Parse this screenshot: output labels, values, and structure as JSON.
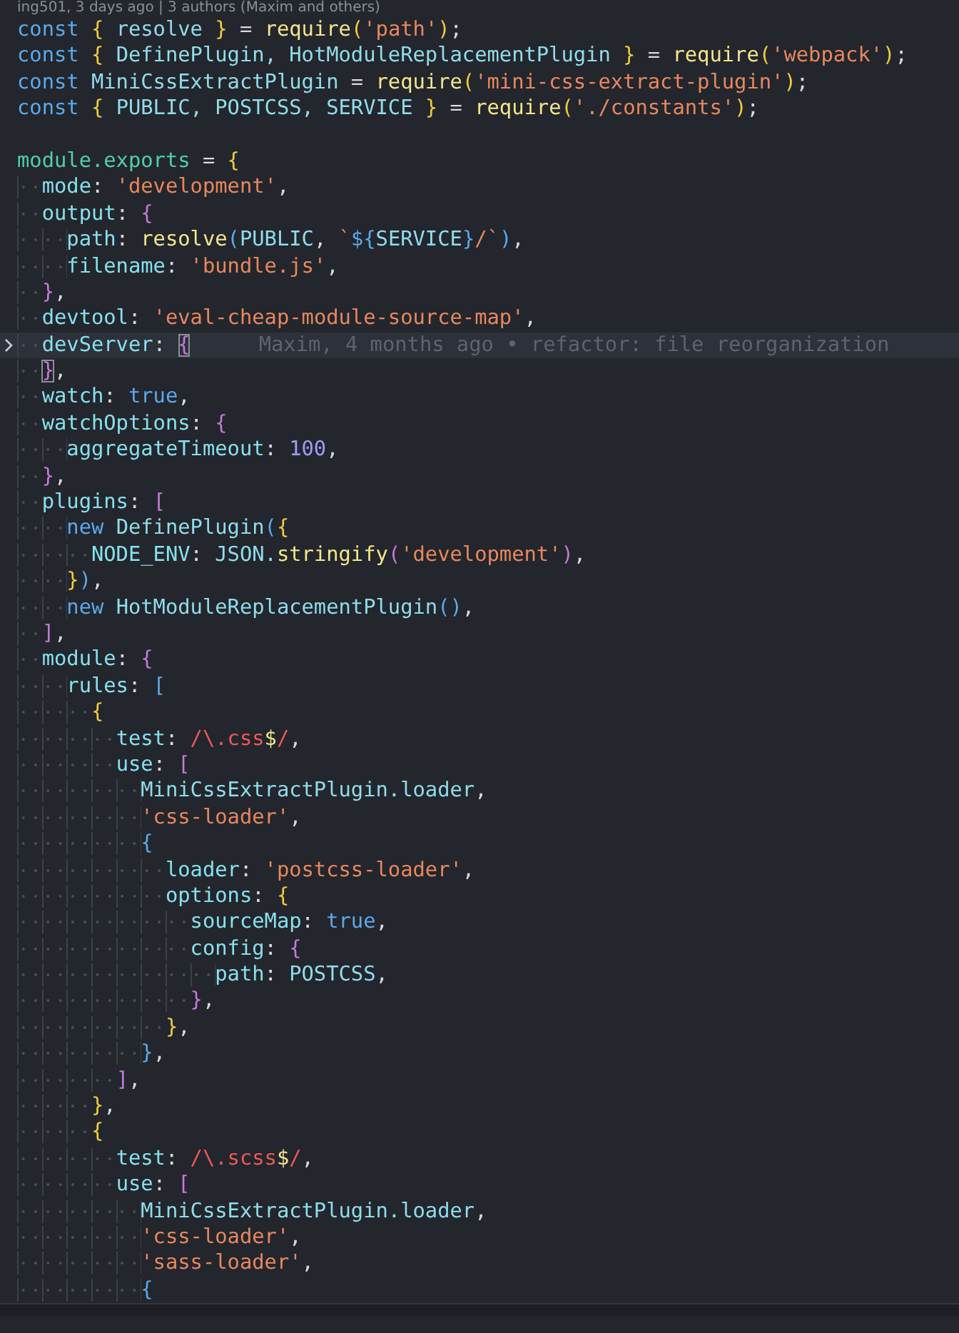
{
  "blame_header": "ing501, 3 days ago | 3 authors (Maxim and others)",
  "lines": [
    {
      "current": false,
      "tokens": [
        {
          "text": "const ",
          "kind": "kw"
        },
        {
          "text": "{",
          "kind": "b1"
        },
        {
          "text": " resolve ",
          "kind": "id"
        },
        {
          "text": "}",
          "kind": "b1"
        },
        {
          "text": " = ",
          "kind": "p"
        },
        {
          "text": "require",
          "kind": "fn"
        },
        {
          "text": "(",
          "kind": "b1"
        },
        {
          "text": "'path'",
          "kind": "str"
        },
        {
          "text": ")",
          "kind": "b1"
        },
        {
          "text": ";",
          "kind": "p"
        }
      ]
    },
    {
      "current": false,
      "tokens": [
        {
          "text": "const ",
          "kind": "kw"
        },
        {
          "text": "{",
          "kind": "b1"
        },
        {
          "text": " DefinePlugin, HotModuleReplacementPlugin ",
          "kind": "id"
        },
        {
          "text": "}",
          "kind": "b1"
        },
        {
          "text": " = ",
          "kind": "p"
        },
        {
          "text": "require",
          "kind": "fn"
        },
        {
          "text": "(",
          "kind": "b1"
        },
        {
          "text": "'webpack'",
          "kind": "str"
        },
        {
          "text": ")",
          "kind": "b1"
        },
        {
          "text": ";",
          "kind": "p"
        }
      ]
    },
    {
      "current": false,
      "tokens": [
        {
          "text": "const ",
          "kind": "kw"
        },
        {
          "text": "MiniCssExtractPlugin",
          "kind": "id"
        },
        {
          "text": " = ",
          "kind": "p"
        },
        {
          "text": "require",
          "kind": "fn"
        },
        {
          "text": "(",
          "kind": "b1"
        },
        {
          "text": "'mini-css-extract-plugin'",
          "kind": "str"
        },
        {
          "text": ")",
          "kind": "b1"
        },
        {
          "text": ";",
          "kind": "p"
        }
      ]
    },
    {
      "current": false,
      "tokens": [
        {
          "text": "const ",
          "kind": "kw"
        },
        {
          "text": "{",
          "kind": "b1"
        },
        {
          "text": " PUBLIC, POSTCSS, SERVICE ",
          "kind": "id"
        },
        {
          "text": "}",
          "kind": "b1"
        },
        {
          "text": " = ",
          "kind": "p"
        },
        {
          "text": "require",
          "kind": "fn"
        },
        {
          "text": "(",
          "kind": "b1"
        },
        {
          "text": "'./constants'",
          "kind": "str"
        },
        {
          "text": ")",
          "kind": "b1"
        },
        {
          "text": ";",
          "kind": "p"
        }
      ]
    },
    {
      "current": false
    },
    {
      "current": false,
      "tokens": [
        {
          "text": "module.exports",
          "kind": "mod"
        },
        {
          "text": " = ",
          "kind": "p"
        },
        {
          "text": "{",
          "kind": "b1"
        }
      ]
    },
    {
      "current": false,
      "tokens": [
        {
          "text": "  mode",
          "kind": "prop"
        },
        {
          "text": ": ",
          "kind": "p"
        },
        {
          "text": "'development'",
          "kind": "str"
        },
        {
          "text": ",",
          "kind": "p"
        }
      ]
    },
    {
      "current": false,
      "tokens": [
        {
          "text": "  output",
          "kind": "prop"
        },
        {
          "text": ": ",
          "kind": "p"
        },
        {
          "text": "{",
          "kind": "b2"
        }
      ]
    },
    {
      "current": false,
      "tokens": [
        {
          "text": "    path",
          "kind": "prop"
        },
        {
          "text": ": ",
          "kind": "p"
        },
        {
          "text": "resolve",
          "kind": "fn"
        },
        {
          "text": "(",
          "kind": "b3"
        },
        {
          "text": "PUBLIC",
          "kind": "id"
        },
        {
          "text": ", ",
          "kind": "p"
        },
        {
          "text": "`",
          "kind": "str"
        },
        {
          "text": "${",
          "kind": "kw"
        },
        {
          "text": "SERVICE",
          "kind": "id"
        },
        {
          "text": "}",
          "kind": "kw"
        },
        {
          "text": "/`",
          "kind": "str"
        },
        {
          "text": ")",
          "kind": "b3"
        },
        {
          "text": ",",
          "kind": "p"
        }
      ]
    },
    {
      "current": false,
      "tokens": [
        {
          "text": "    filename",
          "kind": "prop"
        },
        {
          "text": ": ",
          "kind": "p"
        },
        {
          "text": "'bundle.js'",
          "kind": "str"
        },
        {
          "text": ",",
          "kind": "p"
        }
      ]
    },
    {
      "current": false,
      "tokens": [
        {
          "text": "  }",
          "kind": "b2"
        },
        {
          "text": ",",
          "kind": "p"
        }
      ]
    },
    {
      "current": false,
      "tokens": [
        {
          "text": "  devtool",
          "kind": "prop"
        },
        {
          "text": ": ",
          "kind": "p"
        },
        {
          "text": "'eval-cheap-module-source-map'",
          "kind": "str"
        },
        {
          "text": ",",
          "kind": "p"
        }
      ]
    },
    {
      "current": true,
      "blame": "Maxim, 4 months ago • refactor: file reorganization",
      "tokens": [
        {
          "text": "  devServer",
          "kind": "prop"
        },
        {
          "text": ": ",
          "kind": "p"
        },
        {
          "text": "{",
          "kind": "match"
        }
      ]
    },
    {
      "current": false,
      "tokens": [
        {
          "text": "  }",
          "kind": "match"
        },
        {
          "text": ",",
          "kind": "p"
        }
      ]
    },
    {
      "current": false,
      "tokens": [
        {
          "text": "  watch",
          "kind": "prop"
        },
        {
          "text": ": ",
          "kind": "p"
        },
        {
          "text": "true",
          "kind": "bool"
        },
        {
          "text": ",",
          "kind": "p"
        }
      ]
    },
    {
      "current": false,
      "tokens": [
        {
          "text": "  watchOptions",
          "kind": "prop"
        },
        {
          "text": ": ",
          "kind": "p"
        },
        {
          "text": "{",
          "kind": "b2"
        }
      ]
    },
    {
      "current": false,
      "tokens": [
        {
          "text": "    aggregateTimeout",
          "kind": "prop"
        },
        {
          "text": ": ",
          "kind": "p"
        },
        {
          "text": "100",
          "kind": "num"
        },
        {
          "text": ",",
          "kind": "p"
        }
      ]
    },
    {
      "current": false,
      "tokens": [
        {
          "text": "  }",
          "kind": "b2"
        },
        {
          "text": ",",
          "kind": "p"
        }
      ]
    },
    {
      "current": false,
      "tokens": [
        {
          "text": "  plugins",
          "kind": "prop"
        },
        {
          "text": ": ",
          "kind": "p"
        },
        {
          "text": "[",
          "kind": "b2"
        }
      ]
    },
    {
      "current": false,
      "tokens": [
        {
          "text": "    new ",
          "kind": "kw"
        },
        {
          "text": "DefinePlugin",
          "kind": "id"
        },
        {
          "text": "(",
          "kind": "b3"
        },
        {
          "text": "{",
          "kind": "b1"
        }
      ]
    },
    {
      "current": false,
      "tokens": [
        {
          "text": "      NODE_ENV",
          "kind": "prop"
        },
        {
          "text": ": ",
          "kind": "p"
        },
        {
          "text": "JSON.",
          "kind": "id"
        },
        {
          "text": "stringify",
          "kind": "fn"
        },
        {
          "text": "(",
          "kind": "b2"
        },
        {
          "text": "'development'",
          "kind": "str"
        },
        {
          "text": ")",
          "kind": "b2"
        },
        {
          "text": ",",
          "kind": "p"
        }
      ]
    },
    {
      "current": false,
      "tokens": [
        {
          "text": "    }",
          "kind": "b1"
        },
        {
          "text": ")",
          "kind": "b3"
        },
        {
          "text": ",",
          "kind": "p"
        }
      ]
    },
    {
      "current": false,
      "tokens": [
        {
          "text": "    new ",
          "kind": "kw"
        },
        {
          "text": "HotModuleReplacementPlugin",
          "kind": "id"
        },
        {
          "text": "()",
          "kind": "b3"
        },
        {
          "text": ",",
          "kind": "p"
        }
      ]
    },
    {
      "current": false,
      "tokens": [
        {
          "text": "  ]",
          "kind": "b2"
        },
        {
          "text": ",",
          "kind": "p"
        }
      ]
    },
    {
      "current": false,
      "tokens": [
        {
          "text": "  module",
          "kind": "prop"
        },
        {
          "text": ": ",
          "kind": "p"
        },
        {
          "text": "{",
          "kind": "b2"
        }
      ]
    },
    {
      "current": false,
      "tokens": [
        {
          "text": "    rules",
          "kind": "prop"
        },
        {
          "text": ": ",
          "kind": "p"
        },
        {
          "text": "[",
          "kind": "b3"
        }
      ]
    },
    {
      "current": false,
      "tokens": [
        {
          "text": "      {",
          "kind": "b1"
        }
      ]
    },
    {
      "current": false,
      "tokens": [
        {
          "text": "        test",
          "kind": "prop"
        },
        {
          "text": ": ",
          "kind": "p"
        },
        {
          "text": "/\\.css",
          "kind": "re"
        },
        {
          "text": "$",
          "kind": "rex"
        },
        {
          "text": "/",
          "kind": "re"
        },
        {
          "text": ",",
          "kind": "p"
        }
      ]
    },
    {
      "current": false,
      "tokens": [
        {
          "text": "        use",
          "kind": "prop"
        },
        {
          "text": ": ",
          "kind": "p"
        },
        {
          "text": "[",
          "kind": "b2"
        }
      ]
    },
    {
      "current": false,
      "tokens": [
        {
          "text": "          MiniCssExtractPlugin.loader",
          "kind": "id"
        },
        {
          "text": ",",
          "kind": "p"
        }
      ]
    },
    {
      "current": false,
      "tokens": [
        {
          "text": "          'css-loader'",
          "kind": "str"
        },
        {
          "text": ",",
          "kind": "p"
        }
      ]
    },
    {
      "current": false,
      "tokens": [
        {
          "text": "          {",
          "kind": "b3"
        }
      ]
    },
    {
      "current": false,
      "tokens": [
        {
          "text": "            loader",
          "kind": "prop"
        },
        {
          "text": ": ",
          "kind": "p"
        },
        {
          "text": "'postcss-loader'",
          "kind": "str"
        },
        {
          "text": ",",
          "kind": "p"
        }
      ]
    },
    {
      "current": false,
      "tokens": [
        {
          "text": "            options",
          "kind": "prop"
        },
        {
          "text": ": ",
          "kind": "p"
        },
        {
          "text": "{",
          "kind": "b1"
        }
      ]
    },
    {
      "current": false,
      "tokens": [
        {
          "text": "              sourceMap",
          "kind": "prop"
        },
        {
          "text": ": ",
          "kind": "p"
        },
        {
          "text": "true",
          "kind": "bool"
        },
        {
          "text": ",",
          "kind": "p"
        }
      ]
    },
    {
      "current": false,
      "tokens": [
        {
          "text": "              config",
          "kind": "prop"
        },
        {
          "text": ": ",
          "kind": "p"
        },
        {
          "text": "{",
          "kind": "b2"
        }
      ]
    },
    {
      "current": false,
      "tokens": [
        {
          "text": "                path",
          "kind": "prop"
        },
        {
          "text": ": ",
          "kind": "p"
        },
        {
          "text": "POSTCSS",
          "kind": "id"
        },
        {
          "text": ",",
          "kind": "p"
        }
      ]
    },
    {
      "current": false,
      "tokens": [
        {
          "text": "              }",
          "kind": "b2"
        },
        {
          "text": ",",
          "kind": "p"
        }
      ]
    },
    {
      "current": false,
      "tokens": [
        {
          "text": "            }",
          "kind": "b1"
        },
        {
          "text": ",",
          "kind": "p"
        }
      ]
    },
    {
      "current": false,
      "tokens": [
        {
          "text": "          }",
          "kind": "b3"
        },
        {
          "text": ",",
          "kind": "p"
        }
      ]
    },
    {
      "current": false,
      "tokens": [
        {
          "text": "        ]",
          "kind": "b2"
        },
        {
          "text": ",",
          "kind": "p"
        }
      ]
    },
    {
      "current": false,
      "tokens": [
        {
          "text": "      }",
          "kind": "b1"
        },
        {
          "text": ",",
          "kind": "p"
        }
      ]
    },
    {
      "current": false,
      "tokens": [
        {
          "text": "      {",
          "kind": "b1"
        }
      ]
    },
    {
      "current": false,
      "tokens": [
        {
          "text": "        test",
          "kind": "prop"
        },
        {
          "text": ": ",
          "kind": "p"
        },
        {
          "text": "/\\.scss",
          "kind": "re"
        },
        {
          "text": "$",
          "kind": "rex"
        },
        {
          "text": "/",
          "kind": "re"
        },
        {
          "text": ",",
          "kind": "p"
        }
      ]
    },
    {
      "current": false,
      "tokens": [
        {
          "text": "        use",
          "kind": "prop"
        },
        {
          "text": ": ",
          "kind": "p"
        },
        {
          "text": "[",
          "kind": "b2"
        }
      ]
    },
    {
      "current": false,
      "tokens": [
        {
          "text": "          MiniCssExtractPlugin.loader",
          "kind": "id"
        },
        {
          "text": ",",
          "kind": "p"
        }
      ]
    },
    {
      "current": false,
      "tokens": [
        {
          "text": "          'css-loader'",
          "kind": "str"
        },
        {
          "text": ",",
          "kind": "p"
        }
      ]
    },
    {
      "current": false,
      "tokens": [
        {
          "text": "          'sass-loader'",
          "kind": "str"
        },
        {
          "text": ",",
          "kind": "p"
        }
      ]
    },
    {
      "current": false,
      "tokens": [
        {
          "text": "          {",
          "kind": "b3"
        }
      ]
    }
  ]
}
